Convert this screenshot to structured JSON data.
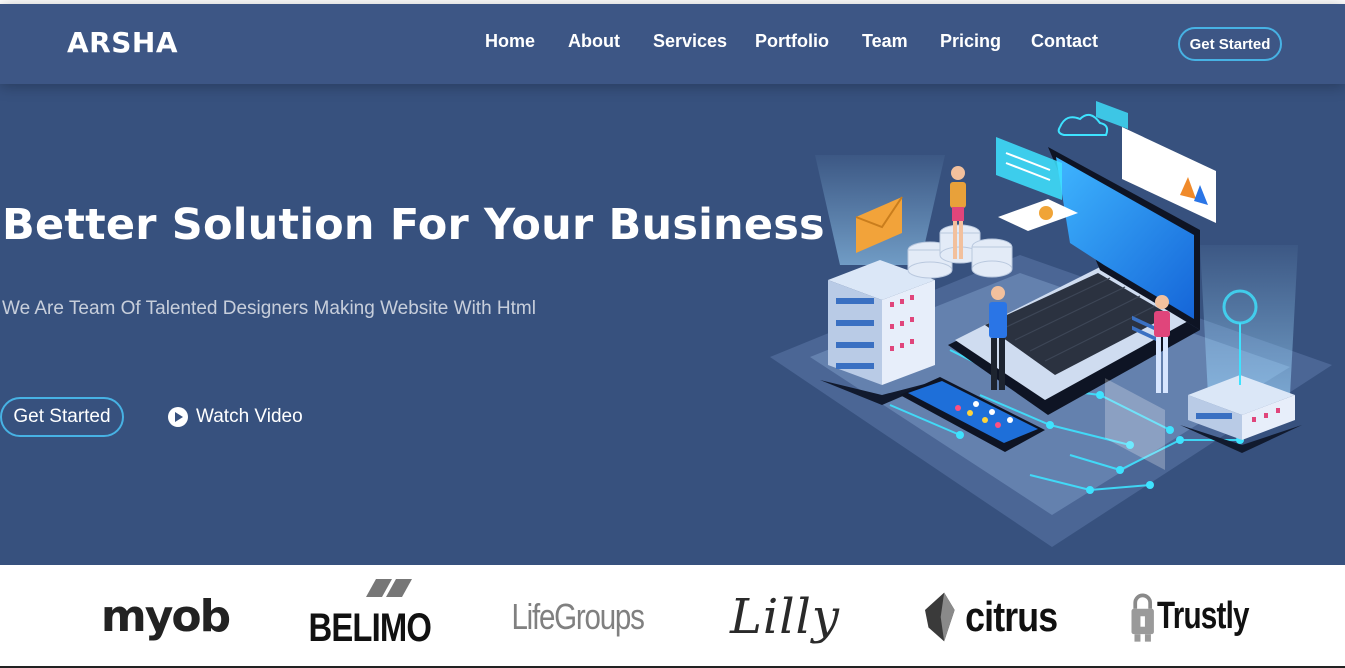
{
  "brand": {
    "logo": "ARSHA"
  },
  "nav": {
    "items": [
      {
        "label": "Home"
      },
      {
        "label": "About"
      },
      {
        "label": "Services"
      },
      {
        "label": "Portfolio"
      },
      {
        "label": "Team"
      },
      {
        "label": "Pricing"
      },
      {
        "label": "Contact"
      }
    ],
    "cta_label": "Get Started"
  },
  "hero": {
    "title": "Better Solution For Your Business",
    "subtitle": "We Are Team Of Talented Designers Making Website With Html",
    "primary_button": "Get Started",
    "video_button": "Watch Video",
    "video_icon": "play-circle-icon",
    "illustration": "isometric-laptop-servers-illustration"
  },
  "clients": {
    "logos": [
      {
        "name": "myob",
        "text": "myob"
      },
      {
        "name": "belimo",
        "text": "BELIMO"
      },
      {
        "name": "lifegroups",
        "text": "LifeGroups"
      },
      {
        "name": "lilly",
        "text": "Lilly"
      },
      {
        "name": "citrus",
        "text": "citrus"
      },
      {
        "name": "trustly",
        "text": "Trustly"
      }
    ]
  },
  "colors": {
    "hero_background": "#37517e",
    "navbar_background": "#3d5685",
    "accent": "#47b2e4",
    "text_light": "#ffffff"
  }
}
